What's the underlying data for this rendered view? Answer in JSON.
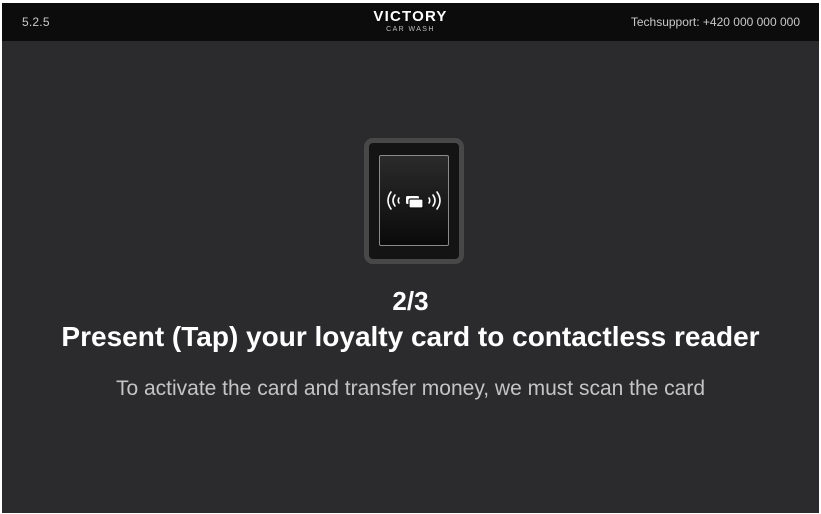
{
  "header": {
    "version": "5.2.5",
    "logo_main": "VICTORY",
    "logo_sub": "CAR WASH",
    "support": "Techsupport: +420 000 000 000"
  },
  "reader": {
    "icon": "contactless-card-icon"
  },
  "main": {
    "step": "2/3",
    "title": "Present (Tap) your loyalty card to contactless reader",
    "subtitle": "To activate the card and transfer money, we must scan the card"
  },
  "colors": {
    "background": "#2b2b2d",
    "topbar": "#0c0c0c",
    "text": "#ffffff",
    "muted_text": "#c4c4c4"
  }
}
